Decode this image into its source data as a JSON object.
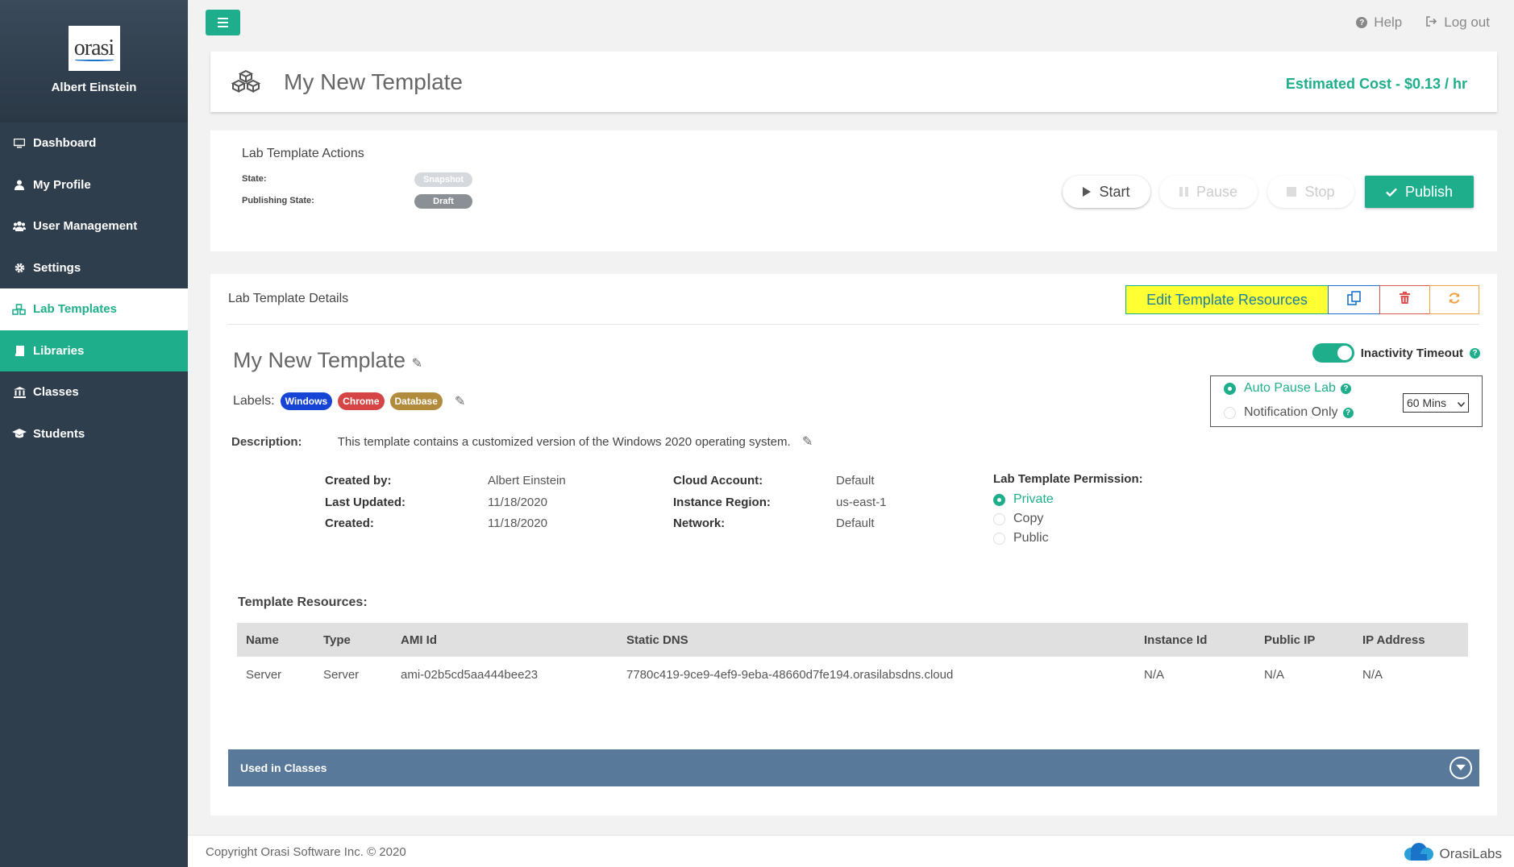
{
  "sidebar": {
    "logo_text": "orasi",
    "user_name": "Albert Einstein",
    "items": [
      {
        "label": "Dashboard",
        "icon": "monitor-icon"
      },
      {
        "label": "My Profile",
        "icon": "user-icon"
      },
      {
        "label": "User Management",
        "icon": "users-icon"
      },
      {
        "label": "Settings",
        "icon": "gear-icon"
      },
      {
        "label": "Lab Templates",
        "icon": "cubes-icon"
      },
      {
        "label": "Libraries",
        "icon": "book-icon"
      },
      {
        "label": "Classes",
        "icon": "institution-icon"
      },
      {
        "label": "Students",
        "icon": "graduation-cap-icon"
      }
    ]
  },
  "topbar": {
    "help_label": "Help",
    "logout_label": "Log out"
  },
  "header": {
    "title": "My New Template",
    "cost": "Estimated Cost - $0.13 / hr"
  },
  "actions": {
    "title": "Lab Template Actions",
    "state_label": "State:",
    "state_value": "Snapshot",
    "publishing_label": "Publishing State:",
    "publishing_value": "Draft",
    "start_label": "Start",
    "pause_label": "Pause",
    "stop_label": "Stop",
    "publish_label": "Publish"
  },
  "details": {
    "title": "Lab Template Details",
    "edit_resources_label": "Edit Template Resources",
    "template_name": "My New Template",
    "labels_title": "Labels:",
    "labels": [
      {
        "text": "Windows",
        "color": "#1644d4"
      },
      {
        "text": "Chrome",
        "color": "#d64545"
      },
      {
        "text": "Database",
        "color": "#b38b3c"
      }
    ],
    "description_label": "Description:",
    "description": "This template contains a customized version of the Windows 2020 operating system.",
    "meta": {
      "created_by_label": "Created by:",
      "created_by": "Albert Einstein",
      "last_updated_label": "Last Updated:",
      "last_updated": "11/18/2020",
      "created_label": "Created:",
      "created": "11/18/2020",
      "cloud_account_label": "Cloud Account:",
      "cloud_account": "Default",
      "instance_region_label": "Instance Region:",
      "instance_region": "us-east-1",
      "network_label": "Network:",
      "network": "Default"
    },
    "permission_title": "Lab Template Permission:",
    "permissions": [
      "Private",
      "Copy",
      "Public"
    ],
    "permission_selected": "Private",
    "inactivity_label": "Inactivity Timeout",
    "inactivity_on": true,
    "auto_pause_label": "Auto Pause Lab",
    "notification_label": "Notification Only",
    "timeout_value": "60 Mins",
    "resources_title": "Template Resources:",
    "resources_columns": [
      "Name",
      "Type",
      "AMI Id",
      "Static DNS",
      "Instance Id",
      "Public IP",
      "IP Address"
    ],
    "resources_rows": [
      [
        "Server",
        "Server",
        "ami-02b5cd5aa444bee23",
        "7780c419-9ce9-4ef9-9eba-48660d7fe194.orasilabsdns.cloud",
        "N/A",
        "N/A",
        "N/A"
      ]
    ],
    "used_in_classes_label": "Used in Classes"
  },
  "footer": {
    "copyright": "Copyright Orasi Software Inc. © 2020",
    "brand": "OrasiLabs"
  },
  "colors": {
    "accent": "#1fae8c",
    "sidebar": "#2f3e4d",
    "highlight": "#ffff33",
    "used_bar": "#58799a"
  }
}
